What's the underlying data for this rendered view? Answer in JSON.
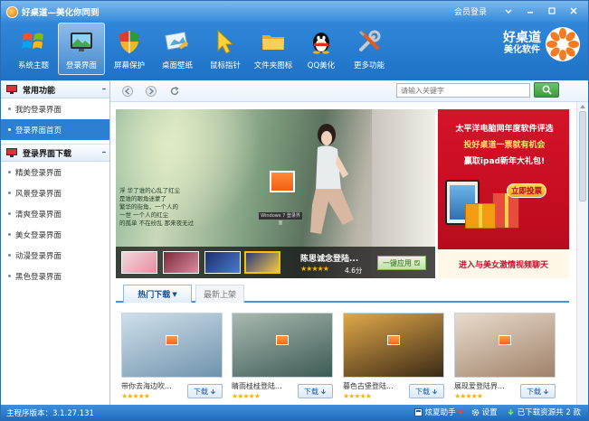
{
  "window": {
    "title": "好桌道—美化你同到",
    "member_login": "会员登录",
    "controls": [
      "menu-icon",
      "minimize-icon",
      "maximize-icon",
      "close-icon"
    ]
  },
  "toolbar": {
    "items": [
      {
        "label": "系统主题",
        "icon": "windows-logo-icon",
        "active": false
      },
      {
        "label": "登录界面",
        "icon": "login-screen-icon",
        "active": true
      },
      {
        "label": "屏幕保护",
        "icon": "shield-icon",
        "active": false
      },
      {
        "label": "桌面壁纸",
        "icon": "wallpaper-icon",
        "active": false
      },
      {
        "label": "鼠标指针",
        "icon": "cursor-icon",
        "active": false
      },
      {
        "label": "文件夹图标",
        "icon": "folder-icon",
        "active": false
      },
      {
        "label": "QQ美化",
        "icon": "qq-penguin-icon",
        "active": false
      },
      {
        "label": "更多功能",
        "icon": "tools-icon",
        "active": false
      }
    ]
  },
  "brand": {
    "name": "好桌道",
    "sub": "美化软件"
  },
  "sidebar": {
    "common": {
      "title": "常用功能",
      "toggle": "–",
      "items": [
        {
          "label": "我的登录界面",
          "active": false
        },
        {
          "label": "登录界面首页",
          "active": true
        }
      ]
    },
    "download": {
      "title": "登录界面下载",
      "toggle": "–",
      "items": [
        {
          "label": "精美登录界面"
        },
        {
          "label": "风景登录界面"
        },
        {
          "label": "清爽登录界面"
        },
        {
          "label": "美女登录界面"
        },
        {
          "label": "动漫登录界面"
        },
        {
          "label": "黑色登录界面"
        }
      ]
    }
  },
  "nav": {
    "search_placeholder": "请输入关键字"
  },
  "banner": {
    "poem": [
      "浮  华了谁的心乱了红尘",
      "是谁的眼角迷蒙了",
      "繁华的街角，一个人的",
      "一世 一个人的红尘",
      "的孤单 不在纷乱 那来夜无过"
    ],
    "mini_label": "Windows 7 登录界面",
    "app_name": "陈思诚念登陆...",
    "stars": "★★★★★",
    "score": "4.6分",
    "apply_label": "一键应用",
    "thumbs": [
      {
        "colors": [
          "#f4d6dc",
          "#e58ea0"
        ]
      },
      {
        "colors": [
          "#7a2a3a",
          "#d98ca0"
        ]
      },
      {
        "colors": [
          "#1c2f6a",
          "#4c7ad0"
        ]
      },
      {
        "colors": [
          "#2a3b7a",
          "#f1c84a"
        ],
        "selected": true
      }
    ]
  },
  "ad": {
    "line1": "太平洋电脑网年度软件评选",
    "line2": "投好桌道一票就有机会",
    "line3": "赢取ipad新年大礼包!",
    "vote_button": "立即投票",
    "bottom": "进入与美女激情视频聊天"
  },
  "tabs": [
    {
      "label": "热门下载",
      "active": true
    },
    {
      "label": "最新上架",
      "active": false
    }
  ],
  "cards": [
    {
      "name": "带你去海边吹...",
      "stars": "★★★★★",
      "download_label": "下载",
      "colors": [
        "#cfe0ea",
        "#6f93ad"
      ]
    },
    {
      "name": "睛雨桂桂登陆...",
      "stars": "★★★★★",
      "download_label": "下载",
      "colors": [
        "#a9b9b0",
        "#3c5b55"
      ]
    },
    {
      "name": "暮色古堡登陆...",
      "stars": "★★★★★",
      "download_label": "下载",
      "colors": [
        "#e0a84a",
        "#3b2a16"
      ]
    },
    {
      "name": "展现爱登陆界...",
      "stars": "★★★★★",
      "download_label": "下载",
      "colors": [
        "#e9dccc",
        "#a0826a"
      ]
    }
  ],
  "status": {
    "version": "主程序版本：3.1.27.131",
    "helper": "炫夏助手",
    "settings": "设置",
    "downloads": "已下载资源共 2 款"
  }
}
